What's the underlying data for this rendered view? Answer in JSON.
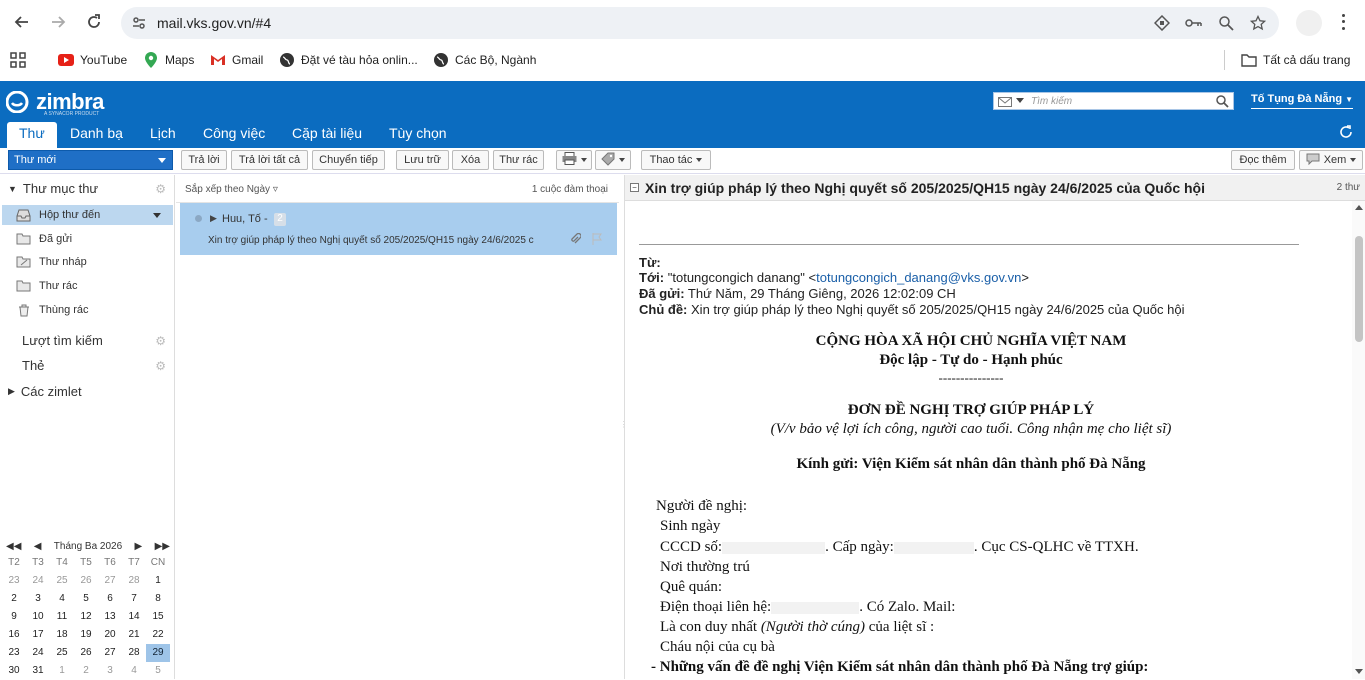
{
  "browser": {
    "url": "mail.vks.gov.vn/#4",
    "bookmarks": [
      "YouTube",
      "Maps",
      "Gmail",
      "Đặt vé tàu hỏa onlin...",
      "Các Bộ, Ngành"
    ],
    "all_bookmarks": "Tất cả dấu trang"
  },
  "zimbra": {
    "logo": "zimbra",
    "logo_sub": "A SYNACOR PRODUCT",
    "search_placeholder": "Tìm kiếm",
    "user": "Tố Tụng Đà Nẵng",
    "tabs": [
      "Thư",
      "Danh bạ",
      "Lịch",
      "Công việc",
      "Cặp tài liệu",
      "Tùy chọn"
    ]
  },
  "toolbar": {
    "new_mail": "Thư mới",
    "reply": "Trả lời",
    "reply_all": "Trả lời tất cả",
    "forward": "Chuyển tiếp",
    "archive": "Lưu trữ",
    "delete": "Xóa",
    "spam": "Thư rác",
    "actions": "Thao tác",
    "read_more": "Đọc thêm",
    "view": "Xem"
  },
  "sidebar": {
    "mail_folders": "Thư mục thư",
    "folders": [
      {
        "label": "Hộp thư đến",
        "icon": "inbox-icon",
        "selected": true
      },
      {
        "label": "Đã gửi",
        "icon": "sent-icon"
      },
      {
        "label": "Thư nháp",
        "icon": "drafts-icon"
      },
      {
        "label": "Thư rác",
        "icon": "junk-icon"
      },
      {
        "label": "Thùng rác",
        "icon": "trash-icon"
      }
    ],
    "searches": "Lượt tìm kiếm",
    "tags": "Thẻ",
    "zimlets": "Các zimlet"
  },
  "calendar": {
    "month": "Tháng Ba 2026",
    "weekdays": [
      "T2",
      "T3",
      "T4",
      "T5",
      "T6",
      "T7",
      "CN"
    ],
    "weeks": [
      [
        "23",
        "24",
        "25",
        "26",
        "27",
        "28",
        "1"
      ],
      [
        "2",
        "3",
        "4",
        "5",
        "6",
        "7",
        "8"
      ],
      [
        "9",
        "10",
        "11",
        "12",
        "13",
        "14",
        "15"
      ],
      [
        "16",
        "17",
        "18",
        "19",
        "20",
        "21",
        "22"
      ],
      [
        "23",
        "24",
        "25",
        "26",
        "27",
        "28",
        "29"
      ],
      [
        "30",
        "31",
        "1",
        "2",
        "3",
        "4",
        "5"
      ]
    ],
    "today": "29"
  },
  "list": {
    "sort": "Sắp xếp theo Ngày",
    "count": "1 cuộc đàm thoại",
    "conversation": {
      "from": "Huu, Tố -",
      "msg_count": "2",
      "subject": "Xin trợ giúp pháp lý theo Nghị quyết số 205/2025/QH15 ngày 24/6/2025 c"
    }
  },
  "reader": {
    "subject": "Xin trợ giúp pháp lý theo Nghị quyết số 205/2025/QH15 ngày 24/6/2025 của Quốc hội",
    "msg_count": "2 thư",
    "from_label": "Từ:",
    "to_label": "Tới:",
    "to_name": "\"totungcongich danang\" <",
    "to_email": "totungcongich_danang@vks.gov.vn",
    "to_close": ">",
    "date_label": "Đã gửi:",
    "date": "Thứ Năm, 29 Tháng Giêng, 2026 12:02:09 CH",
    "subject_label": "Chủ đề:",
    "subject_value": "Xin trợ giúp pháp lý theo Nghị quyết số 205/2025/QH15 ngày 24/6/2025 của Quốc hội",
    "body": {
      "nation": "CỘNG HÒA XÃ HỘI CHỦ NGHĨA VIỆT NAM",
      "motto": "Độc lập - Tự do - Hạnh phúc",
      "dashes": "---------------",
      "title": "ĐƠN ĐỀ NGHỊ TRỢ GIÚP PHÁP LÝ",
      "subtitle": "(V/v bảo vệ lợi ích công, người cao tuổi. Công nhận mẹ cho liệt sĩ)",
      "to": "Kính gửi: Viện Kiểm sát nhân dân thành phố Đà Nẵng",
      "l1": "Người đề nghị:",
      "l2": "Sinh ngày",
      "l3a": "CCCD số:",
      "l3b": ". Cấp ngày:",
      "l3c": ". Cục CS-QLHC về TTXH.",
      "l4": "Nơi thường trú",
      "l5": "Quê quán:",
      "l6a": "Điện thoại liên hệ:",
      "l6b": ". Có Zalo. Mail:",
      "l7a": "Là con duy nhất ",
      "l7b": "(Người thờ cúng)",
      "l7c": " của liệt sĩ :",
      "l8": "Cháu nội của cụ bà",
      "l9": "- Những vấn đề đề nghị Viện Kiểm sát nhân dân thành phố Đà Nẵng trợ giúp:"
    }
  }
}
